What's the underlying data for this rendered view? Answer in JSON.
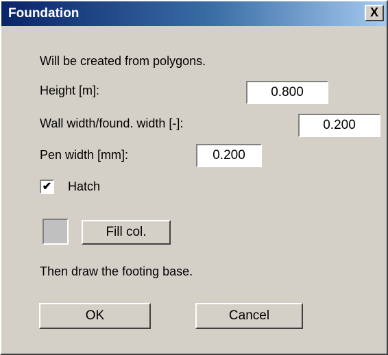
{
  "window": {
    "title": "Foundation",
    "close_label": "X"
  },
  "info": {
    "top": "Will be created from polygons.",
    "bottom": "Then draw the footing base."
  },
  "fields": {
    "height": {
      "label": "Height [m]:",
      "value": "0.800"
    },
    "wall_width": {
      "label": "Wall width/found. width [-]:",
      "value": "0.200"
    },
    "pen_width": {
      "label": "Pen width [mm]:",
      "value": "0.200"
    }
  },
  "hatch": {
    "label": "Hatch",
    "checked": true,
    "check_glyph": "✔"
  },
  "fill": {
    "button_label": "Fill col.",
    "swatch_color": "#c0c0c0"
  },
  "buttons": {
    "ok": "OK",
    "cancel": "Cancel"
  }
}
